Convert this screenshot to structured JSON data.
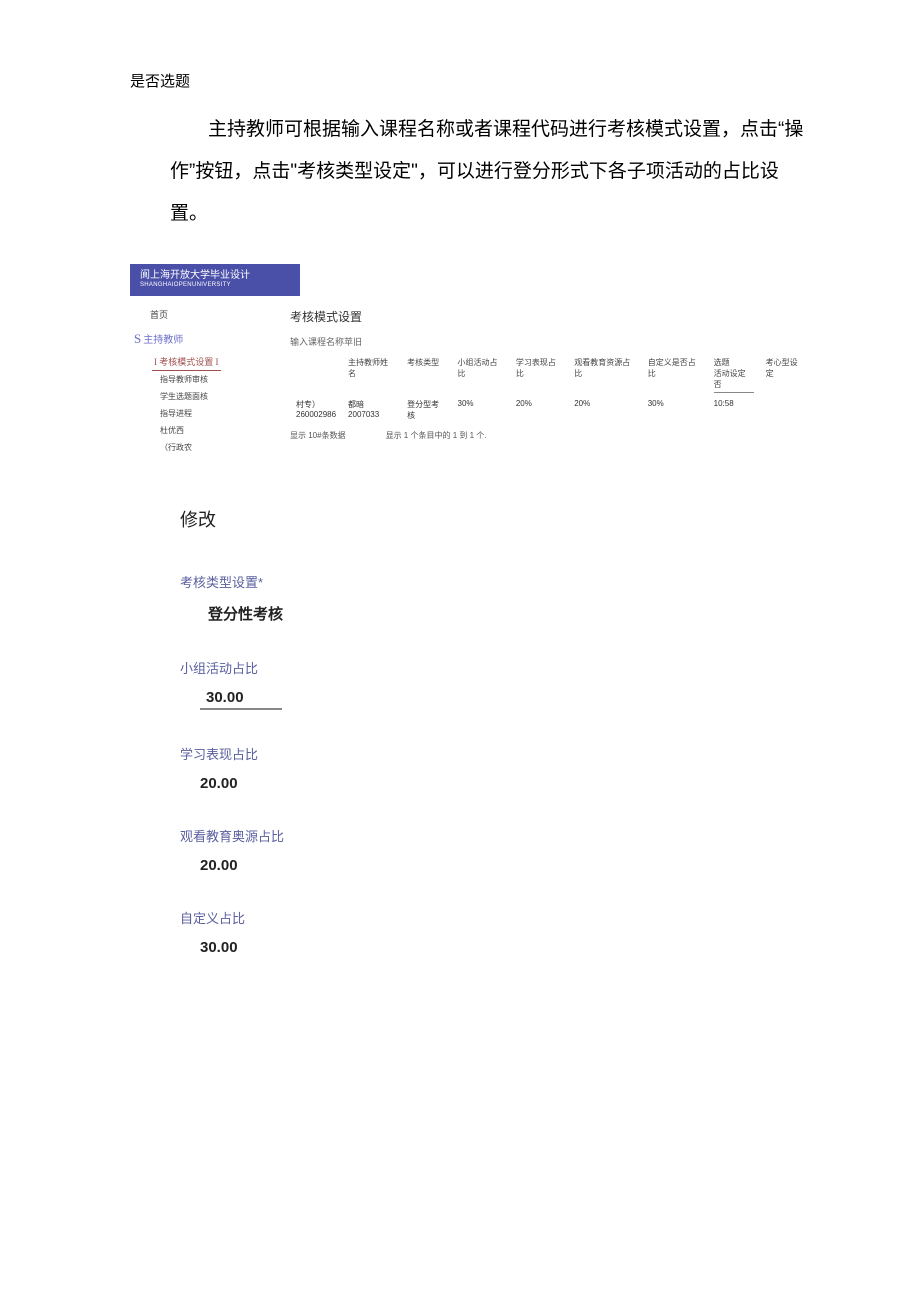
{
  "top_label": "是否选题",
  "intro": "主持教师可根据输入课程名称或者课程代码进行考核模式设置，点击“操作”按钮，点击\"考核类型设定\"，可以进行登分形式下各子项活动的占比设置。",
  "shot": {
    "header_line1": "阆上海开放大学毕业设计",
    "header_line2": "SHANGHAIOPENUNIVERSITY",
    "sidebar": {
      "home": "首页",
      "section_letter": "S",
      "section_label": "主持教师",
      "active": "考核模式设置",
      "items": [
        "指导教师审核",
        "学生选题面核",
        "指导进程",
        "杜优西",
        "（行政农"
      ]
    },
    "main_title": "考核模式设置",
    "search_placeholder": "输入课程名称苹旧",
    "table": {
      "headers": [
        "",
        "主持教师姓名",
        "考核类型",
        "小组活动占比",
        "学习表现占比",
        "观看教育资源占比",
        "自定义是否占比",
        "选题\n活动设定\n否",
        "考心型设定"
      ],
      "row": {
        "c0a": "村专）",
        "c0b": "260002986",
        "c1a": "都暗",
        "c1b": "2007033",
        "c2": "登分型考核",
        "c3": "30%",
        "c4": "20%",
        "c5": "20%",
        "c6": "30%",
        "c7": "10:58"
      }
    },
    "footer_left": "显示 10#条数据",
    "footer_right": "显示 1 个条目中的 1 到 1 个."
  },
  "form": {
    "heading": "修改",
    "type_label": "考核类型设置*",
    "type_value": "登分性考核",
    "group_label": "小组活动占比",
    "group_value": "30.00",
    "study_label": "学习表现占比",
    "study_value": "20.00",
    "edu_label": "观看教育奥源占比",
    "edu_value": "20.00",
    "custom_label": "自定义占比",
    "custom_value": "30.00"
  }
}
